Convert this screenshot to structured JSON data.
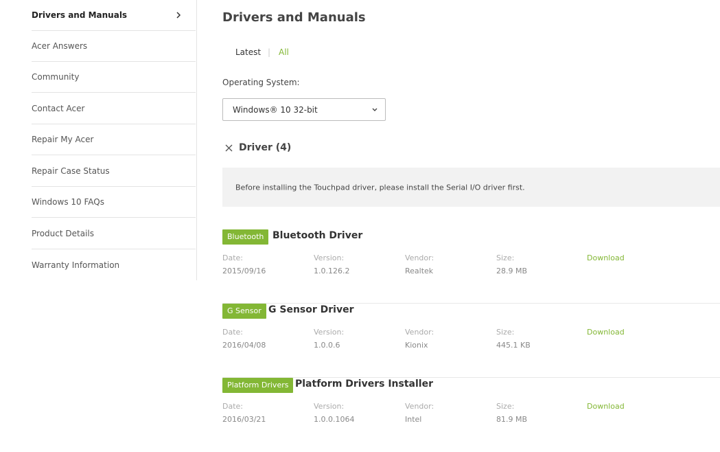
{
  "sidebar": {
    "items": [
      {
        "label": "Drivers and Manuals"
      },
      {
        "label": "Acer Answers"
      },
      {
        "label": "Community"
      },
      {
        "label": "Contact Acer"
      },
      {
        "label": "Repair My Acer"
      },
      {
        "label": "Repair Case Status"
      },
      {
        "label": "Windows 10 FAQs"
      },
      {
        "label": "Product Details"
      },
      {
        "label": "Warranty Information"
      }
    ]
  },
  "main": {
    "title": "Drivers and Manuals",
    "tabs": {
      "latest": "Latest",
      "separator": "|",
      "all": "All"
    },
    "os_label": "Operating System:",
    "os_value": "Windows® 10 32-bit",
    "section_title": "Driver (4)",
    "notice": "Before installing the Touchpad driver, please install the Serial I/O driver first.",
    "col_labels": {
      "date": "Date:",
      "version": "Version:",
      "vendor": "Vendor:",
      "size": "Size:"
    },
    "download_label": "Download",
    "drivers": [
      {
        "badge": "Bluetooth",
        "name": "Bluetooth Driver",
        "date": "2015/09/16",
        "version": "1.0.126.2",
        "vendor": "Realtek",
        "size": "28.9 MB"
      },
      {
        "badge": "G Sensor",
        "name": "G Sensor Driver",
        "date": "2016/04/08",
        "version": "1.0.0.6",
        "vendor": "Kionix",
        "size": "445.1 KB"
      },
      {
        "badge": "Platform Drivers",
        "name": "Platform Drivers Installer",
        "date": "2016/03/21",
        "version": "1.0.0.1064",
        "vendor": "Intel",
        "size": "81.9 MB"
      }
    ]
  },
  "colors": {
    "accent": "#83b735",
    "divider": "#e3e3e3",
    "notice_bg": "#f2f2f2"
  }
}
